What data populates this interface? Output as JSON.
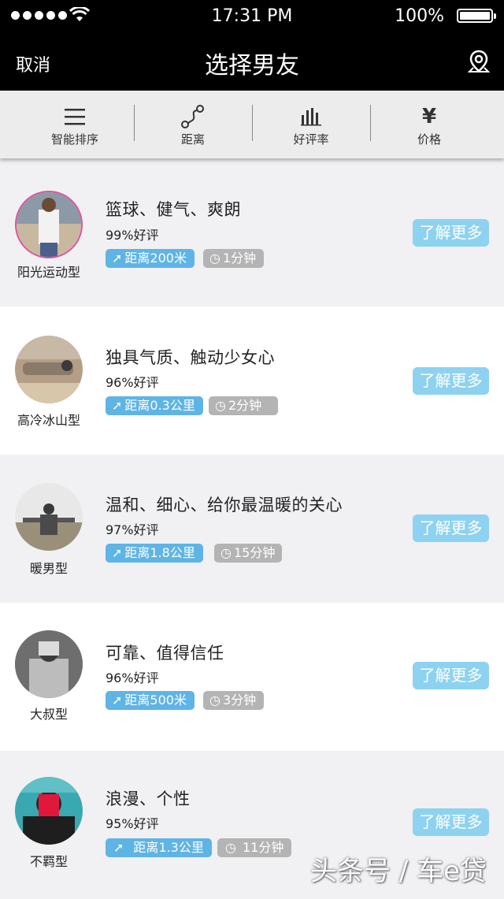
{
  "status_bar": {
    "time": "17:31 PM",
    "battery": "100%"
  },
  "nav": {
    "cancel": "取消",
    "title": "选择男友"
  },
  "filters": [
    {
      "label": "智能排序",
      "icon": "menu-icon"
    },
    {
      "label": "距离",
      "icon": "route-icon"
    },
    {
      "label": "好评率",
      "icon": "bar-chart-icon"
    },
    {
      "label": "价格",
      "icon": "yen-icon"
    }
  ],
  "items": [
    {
      "type": "阳光运动型",
      "headline": "篮球、健气、爽朗",
      "rating": "99%好评",
      "distance": "距离200米",
      "time": "1分钟",
      "more": "了解更多"
    },
    {
      "type": "高冷冰山型",
      "headline": "独具气质、触动少女心",
      "rating": "96%好评",
      "distance": "距离0.3公里",
      "time": "2分钟",
      "more": "了解更多"
    },
    {
      "type": "暖男型",
      "headline": "温和、细心、给你最温暖的关心",
      "rating": "97%好评",
      "distance": "距离1.8公里",
      "time": "15分钟",
      "more": "了解更多"
    },
    {
      "type": "大叔型",
      "headline": "可靠、值得信任",
      "rating": "96%好评",
      "distance": "距离500米",
      "time": "3分钟",
      "more": "了解更多"
    },
    {
      "type": "不羁型",
      "headline": "浪漫、个性",
      "rating": "95%好评",
      "distance": "距离1.3公里",
      "time": "11分钟",
      "more": "了解更多"
    }
  ],
  "watermark": "头条号 / 车e贷",
  "colors": {
    "accent": "#5fb4e6",
    "button": "#8ed2f1",
    "time_tag": "#b4b4b4",
    "nav_bg": "#000000"
  }
}
